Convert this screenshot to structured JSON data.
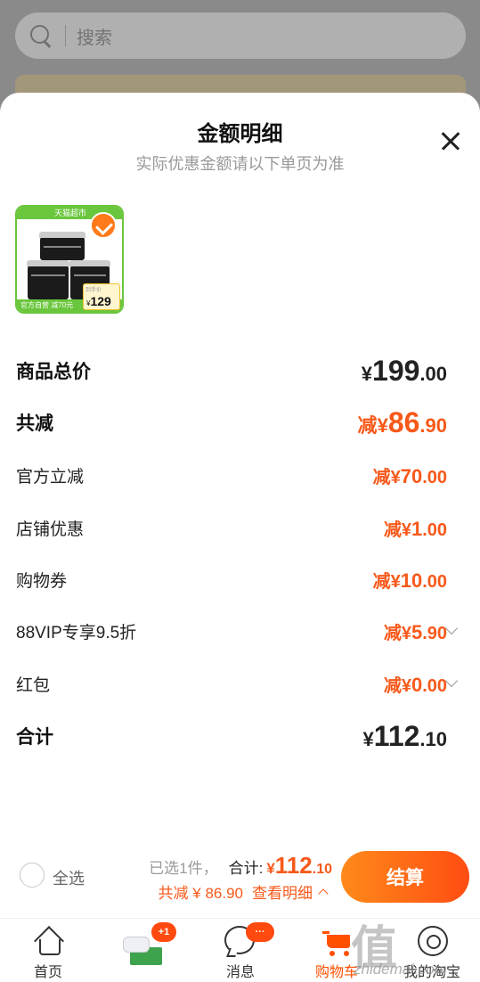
{
  "background": {
    "search_placeholder": "搜索"
  },
  "sheet": {
    "title": "金额明细",
    "subtitle": "实际优惠金额请以下单页为准"
  },
  "product": {
    "tag": "天猫超市",
    "footer_label": "官方自营 减70元",
    "price_caption": "到手价",
    "price_currency": "¥",
    "price_value": "129",
    "selected": true
  },
  "rows": [
    {
      "label": "商品总价",
      "prefix": "",
      "currency": "¥",
      "int": "199",
      "dec": ".00"
    },
    {
      "label": "共减",
      "prefix": "减",
      "currency": "¥",
      "int": "86",
      "dec": ".90"
    },
    {
      "label": "官方立减",
      "prefix": "减",
      "currency": "¥",
      "int": "70",
      "dec": ".00"
    },
    {
      "label": "店铺优惠",
      "prefix": "减",
      "currency": "¥",
      "int": "1",
      "dec": ".00"
    },
    {
      "label": "购物券",
      "prefix": "减",
      "currency": "¥",
      "int": "10",
      "dec": ".00"
    },
    {
      "label": "88VIP专享9.5折",
      "prefix": "减",
      "currency": "¥",
      "int": "5",
      "dec": ".90"
    },
    {
      "label": "红包",
      "prefix": "减",
      "currency": "¥",
      "int": "0",
      "dec": ".00"
    },
    {
      "label": "合计",
      "prefix": "",
      "currency": "¥",
      "int": "112",
      "dec": ".10"
    }
  ],
  "checkout": {
    "select_all": "全选",
    "selected_count": "已选1件，",
    "total_label": "合计:",
    "total_currency": "¥",
    "total_int": "112",
    "total_dec": ".10",
    "discount_text": "共减 ¥ 86.90",
    "detail_link": "查看明细",
    "pay_button": "结算"
  },
  "tabbar": {
    "tabs": [
      {
        "label": "首页"
      },
      {
        "label": "",
        "badge": "+1"
      },
      {
        "label": "消息",
        "badge": "···"
      },
      {
        "label": "购物车"
      },
      {
        "label": "我的淘宝"
      }
    ]
  },
  "watermark": {
    "mark": "值什么值得买",
    "url": "zhidemai.com"
  },
  "colors": {
    "accent": "#ff5000",
    "price_orange": "#f7591a",
    "tmall_green": "#6ac63c"
  }
}
